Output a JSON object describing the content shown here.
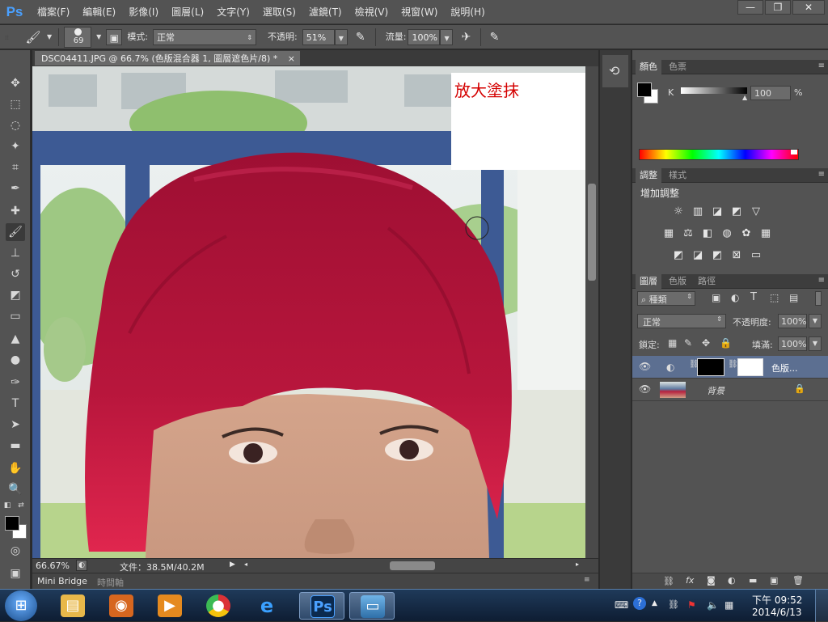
{
  "app": {
    "logo": "Ps"
  },
  "menu": [
    "檔案(F)",
    "編輯(E)",
    "影像(I)",
    "圖層(L)",
    "文字(Y)",
    "選取(S)",
    "濾鏡(T)",
    "檢視(V)",
    "視窗(W)",
    "說明(H)"
  ],
  "window_buttons": {
    "minimize": "—",
    "restore": "❐",
    "close": "✕"
  },
  "options": {
    "brush_size": "69",
    "mode_label": "模式:",
    "mode_value": "正常",
    "opacity_label": "不透明:",
    "opacity_value": "51%",
    "flow_label": "流量:",
    "flow_value": "100%"
  },
  "document": {
    "tab_title": "DSC04411.JPG @ 66.7% (色版混合器 1, 圖層遮色片/8) *",
    "tab_close": "×",
    "overlay_text": "放大塗抹",
    "zoom": "66.67%",
    "file_info": "文件：38.5M/40.2M"
  },
  "bridge_tabs": [
    "Mini Bridge",
    "時間軸"
  ],
  "color_panel": {
    "tabs": [
      "顏色",
      "色票"
    ],
    "channel": "K",
    "value": "100",
    "unit": "%",
    "foreground": "#000000",
    "background": "#ffffff"
  },
  "adjust_panel": {
    "tabs": [
      "調整",
      "樣式"
    ],
    "title": "增加調整",
    "icons": [
      [
        "brightness-icon",
        "levels-icon",
        "curves-icon",
        "exposure-icon",
        "vibrance-icon"
      ],
      [
        "hue-saturation-icon",
        "color-balance-icon",
        "black-white-icon",
        "photo-filter-icon",
        "channel-mixer-icon",
        "color-lookup-icon"
      ],
      [
        "invert-icon",
        "posterize-icon",
        "threshold-icon",
        "selective-color-icon",
        "gradient-map-icon"
      ]
    ]
  },
  "layers_panel": {
    "tabs": [
      "圖層",
      "色版",
      "路徑"
    ],
    "filter_kind": "種類",
    "blend_mode": "正常",
    "opacity_label": "不透明度:",
    "opacity_value": "100%",
    "lock_label": "鎖定:",
    "fill_label": "填滿:",
    "fill_value": "100%",
    "layers": [
      {
        "name": "色版...",
        "selected": true
      },
      {
        "name": "背景",
        "selected": false
      }
    ]
  },
  "taskbar": {
    "start_glyph": "⊞",
    "clock_time": "下午 09:52",
    "clock_date": "2014/6/13"
  },
  "colors": {
    "hair_paint": "#c4173c",
    "ui_dark": "#535353",
    "overlay_text": "#d40000"
  }
}
